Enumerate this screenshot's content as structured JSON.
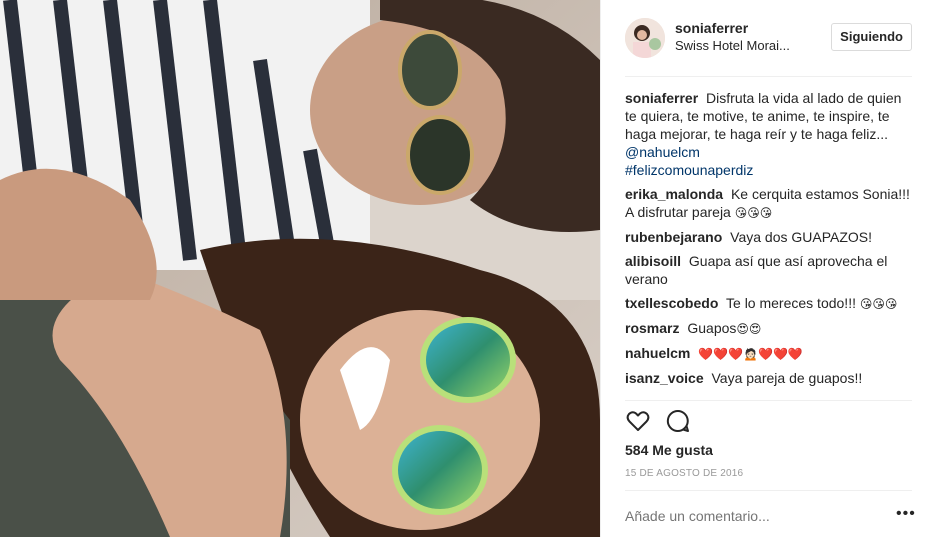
{
  "post": {
    "username": "soniaferrer",
    "location": "Swiss Hotel Morai...",
    "follow_label": "Siguiendo",
    "caption": {
      "username": "soniaferrer",
      "text": "Disfruta la vida al lado de quien te quiera, te motive, te anime, te inspire, te haga mejorar, te haga reír y te haga feliz...",
      "mention": "@nahuelcm",
      "hashtag": "#felizcomounaperdiz"
    },
    "comments": [
      {
        "username": "erika_malonda",
        "text": "Ke cerquita estamos Sonia!!! A disfrutar pareja",
        "emoji": "😘😘😘"
      },
      {
        "username": "rubenbejarano",
        "text": "Vaya dos GUAPAZOS!",
        "emoji": ""
      },
      {
        "username": "alibisoill",
        "text": "Guapa así que así aprovecha el verano",
        "emoji": ""
      },
      {
        "username": "txellescobedo",
        "text": "Te lo mereces todo!!!",
        "emoji": "😘😘😘"
      },
      {
        "username": "rosmarz",
        "text": "Guapos",
        "emoji": "😍😍"
      },
      {
        "username": "nahuelcm",
        "text": "",
        "emoji": "❤️❤️❤️🙍🏻❤️❤️❤️"
      },
      {
        "username": "isanz_voice",
        "text": "Vaya pareja de guapos!!",
        "emoji": ""
      }
    ],
    "likes": "584 Me gusta",
    "date": "15 DE AGOSTO DE 2016",
    "add_comment_placeholder": "Añade un comentario...",
    "more_label": "•••"
  },
  "icons": {
    "like": "heart-icon",
    "comment": "comment-icon",
    "more": "more-options-icon"
  }
}
